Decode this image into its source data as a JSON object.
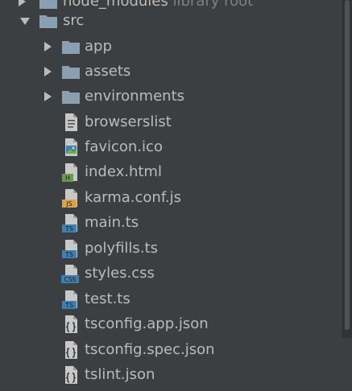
{
  "tree": {
    "cut_row": {
      "label": "node_modules",
      "hint": "library root"
    },
    "src": {
      "label": "src"
    },
    "folders": [
      {
        "label": "app"
      },
      {
        "label": "assets"
      },
      {
        "label": "environments"
      }
    ],
    "files": [
      {
        "label": "browserslist",
        "icon": "text-file-icon"
      },
      {
        "label": "favicon.ico",
        "icon": "image-file-icon"
      },
      {
        "label": "index.html",
        "icon": "html-file-icon",
        "badge": "H"
      },
      {
        "label": "karma.conf.js",
        "icon": "js-file-icon",
        "badge": "JS"
      },
      {
        "label": "main.ts",
        "icon": "ts-file-icon",
        "badge": "TS"
      },
      {
        "label": "polyfills.ts",
        "icon": "ts-file-icon",
        "badge": "TS"
      },
      {
        "label": "styles.css",
        "icon": "css-file-icon",
        "badge": "CSS"
      },
      {
        "label": "test.ts",
        "icon": "ts-file-icon",
        "badge": "TS"
      },
      {
        "label": "tsconfig.app.json",
        "icon": "json-file-icon"
      },
      {
        "label": "tsconfig.spec.json",
        "icon": "json-file-icon"
      },
      {
        "label": "tslint.json",
        "icon": "json-file-icon"
      }
    ]
  },
  "colors": {
    "background": "#3c3f41",
    "text": "#bbbbbb",
    "folder": "#8aa0b1",
    "html_badge": "#6a9b4f",
    "js_badge": "#d7a44a",
    "ts_badge": "#3f7fb1",
    "css_badge": "#3f7fb1"
  }
}
